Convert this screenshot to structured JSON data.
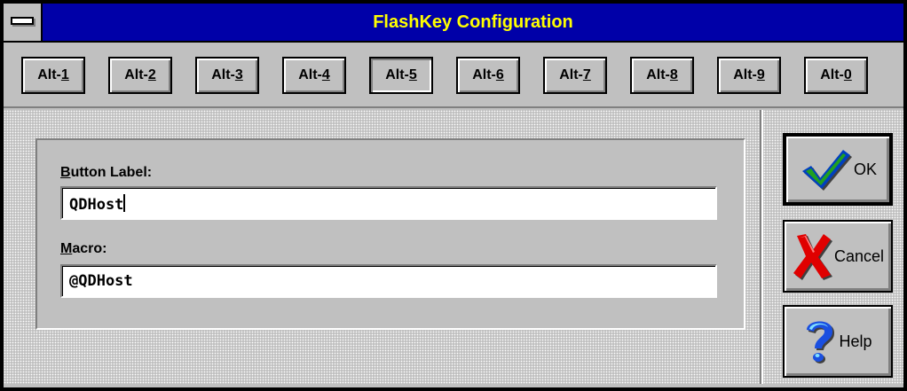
{
  "window": {
    "title": "FlashKey Configuration"
  },
  "toolbar": {
    "buttons": [
      {
        "prefix": "Alt-",
        "key": "1"
      },
      {
        "prefix": "Alt-",
        "key": "2"
      },
      {
        "prefix": "Alt-",
        "key": "3"
      },
      {
        "prefix": "Alt-",
        "key": "4"
      },
      {
        "prefix": "Alt-",
        "key": "5"
      },
      {
        "prefix": "Alt-",
        "key": "6"
      },
      {
        "prefix": "Alt-",
        "key": "7"
      },
      {
        "prefix": "Alt-",
        "key": "8"
      },
      {
        "prefix": "Alt-",
        "key": "9"
      },
      {
        "prefix": "Alt-",
        "key": "0"
      }
    ],
    "selected_key": "5"
  },
  "form": {
    "button_label": {
      "accel": "B",
      "rest": "utton Label:",
      "value": "QDHost"
    },
    "macro": {
      "accel": "M",
      "rest": "acro:",
      "value": "@QDHost"
    }
  },
  "actions": {
    "ok": {
      "label": "OK",
      "icon": "checkmark-icon"
    },
    "cancel": {
      "label": "Cancel",
      "icon": "red-x-icon"
    },
    "help": {
      "label": "Help",
      "icon": "question-mark-icon"
    }
  },
  "colors": {
    "titlebar": "#0000a8",
    "title_text": "#ffff00",
    "face": "#c0c0c0"
  }
}
